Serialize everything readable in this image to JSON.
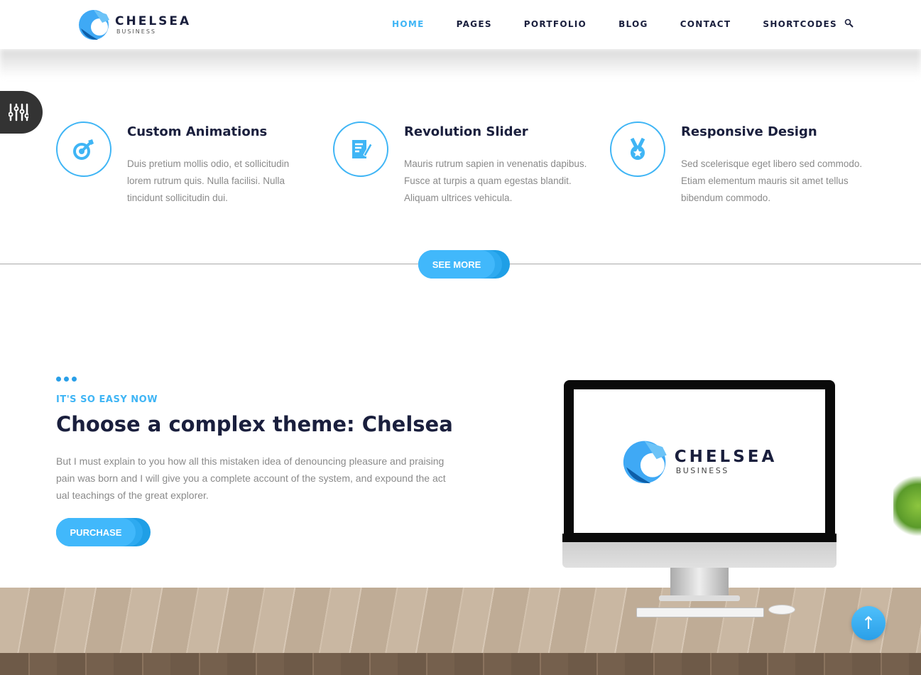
{
  "brand": {
    "name": "CHELSEA",
    "tagline": "BUSINESS"
  },
  "nav": {
    "items": [
      {
        "label": "HOME",
        "active": true
      },
      {
        "label": "PAGES"
      },
      {
        "label": "PORTFOLIO"
      },
      {
        "label": "BLOG"
      },
      {
        "label": "CONTACT"
      },
      {
        "label": "SHORTCODES"
      }
    ],
    "search_icon": "search-icon"
  },
  "colors": {
    "accent": "#3fb5f5",
    "dark": "#1a1f3d",
    "button": "#41b8fb"
  },
  "features": [
    {
      "icon": "target-icon",
      "title": "Custom Animations",
      "desc": "Duis pretium mollis odio, et sollicitudin lorem rutrum quis. Nulla facilisi. Nulla tincidunt sollicitudin dui."
    },
    {
      "icon": "document-edit-icon",
      "title": "Revolution Slider",
      "desc": "Mauris rutrum sapien in venenatis dapibus. Fusce at turpis a quam egestas blandit. Aliquam ultrices vehicula."
    },
    {
      "icon": "medal-icon",
      "title": "Responsive Design",
      "desc": "Sed scelerisque eget libero sed commodo. Etiam elementum mauris sit amet tellus bibendum commodo."
    }
  ],
  "see_more": "SEE MORE",
  "promo": {
    "kicker": "IT'S SO EASY NOW",
    "title": "Choose a complex theme: Chelsea",
    "text": "But I must explain to you how all this mistaken idea of denouncing pleasure and praising pain was born and I will give you a complete account of the system, and expound the act ual teachings of the great explorer.",
    "button": "PURCHASE"
  },
  "screen_logo": {
    "name": "CHELSEA",
    "tagline": "BUSINESS"
  }
}
